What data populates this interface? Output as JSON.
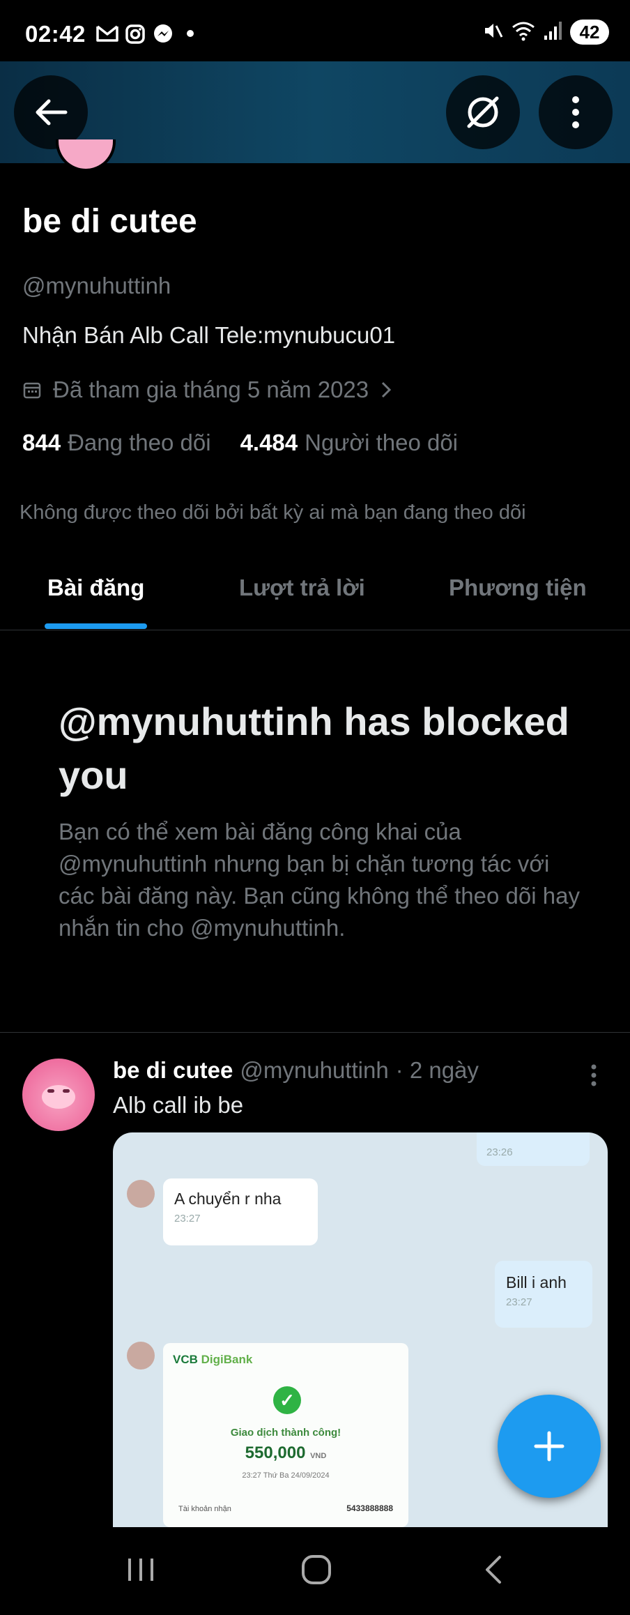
{
  "status_bar": {
    "time": "02:42",
    "battery": "42",
    "left_icons": [
      "gmail-icon",
      "instagram-icon",
      "messenger-icon"
    ],
    "right_icons": [
      "mute-icon",
      "wifi-icon",
      "signal-icon"
    ]
  },
  "header": {
    "back_icon": "arrow-left-icon",
    "grok_icon": "grok-icon",
    "more_icon": "more-vertical-icon"
  },
  "profile": {
    "name": "be di cutee",
    "handle": "@mynuhuttinh",
    "bio": "Nhận Bán Alb Call Tele:mynubucu01",
    "joined": "Đã tham gia tháng 5 năm 2023",
    "following_count": "844",
    "following_label": "Đang theo dõi",
    "followers_count": "4.484",
    "followers_label": "Người theo dõi",
    "not_followed_text": "Không được theo dõi bởi bất kỳ ai mà bạn đang theo dõi"
  },
  "tabs": [
    {
      "label": "Bài đăng",
      "active": true
    },
    {
      "label": "Lượt trả lời",
      "active": false
    },
    {
      "label": "Phương tiện",
      "active": false
    }
  ],
  "blocked": {
    "title": "@mynuhuttinh has blocked you",
    "description": "Bạn có thể xem bài đăng công khai của @mynuhuttinh nhưng bạn bị chặn tương tác với các bài đăng này. Bạn cũng không thể theo dõi hay nhắn tin cho @mynuhuttinh."
  },
  "post": {
    "author_name": "be di cutee",
    "author_handle": "@mynuhuttinh",
    "time": "· 2 ngày",
    "text": "Alb call ib be",
    "media": {
      "bubble_top_time": "23:26",
      "msg1": "A chuyển r nha",
      "msg1_time": "23:27",
      "msg2": "Bill i anh",
      "msg2_time": "23:27",
      "receipt_bank": "VCB",
      "receipt_bank_sub": "DigiBank",
      "receipt_status": "Giao dịch thành công!",
      "receipt_amount": "550,000",
      "receipt_currency": "VND",
      "receipt_date": "23:27 Thứ Ba 24/09/2024",
      "receipt_account_label": "Tài khoản nhận",
      "receipt_account": "5433888888"
    }
  },
  "fab_icon": "plus-icon",
  "nav_bar": {
    "icons": [
      "recents-icon",
      "home-icon",
      "back-icon"
    ]
  },
  "colors": {
    "accent": "#1d9bf0",
    "background": "#000000",
    "muted_text": "#71767b"
  }
}
